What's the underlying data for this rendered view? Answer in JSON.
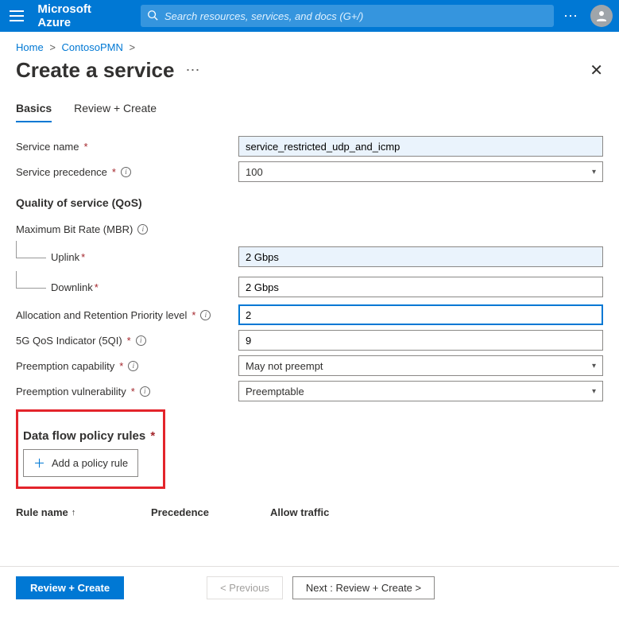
{
  "brand": "Microsoft Azure",
  "search": {
    "placeholder": "Search resources, services, and docs (G+/)"
  },
  "breadcrumb": {
    "home": "Home",
    "parent": "ContosoPMN",
    "sep": ">"
  },
  "page": {
    "title": "Create a service"
  },
  "tabs": {
    "basics": "Basics",
    "review": "Review + Create"
  },
  "form": {
    "service_name_label": "Service name",
    "service_name_value": "service_restricted_udp_and_icmp",
    "service_precedence_label": "Service precedence",
    "service_precedence_value": "100",
    "qos_heading": "Quality of service (QoS)",
    "mbr_label": "Maximum Bit Rate (MBR)",
    "uplink_label": "Uplink",
    "uplink_value": "2 Gbps",
    "downlink_label": "Downlink",
    "downlink_value": "2 Gbps",
    "arp_label": "Allocation and Retention Priority level",
    "arp_value": "2",
    "fiveqi_label": "5G QoS Indicator (5QI)",
    "fiveqi_value": "9",
    "preempt_cap_label": "Preemption capability",
    "preempt_cap_value": "May not preempt",
    "preempt_vul_label": "Preemption vulnerability",
    "preempt_vul_value": "Preemptable"
  },
  "policy": {
    "heading": "Data flow policy rules",
    "add_button": "Add a policy rule",
    "col_rule": "Rule name",
    "col_prec": "Precedence",
    "col_allow": "Allow traffic"
  },
  "footer": {
    "review": "Review + Create",
    "prev": "< Previous",
    "next": "Next : Review + Create >"
  }
}
